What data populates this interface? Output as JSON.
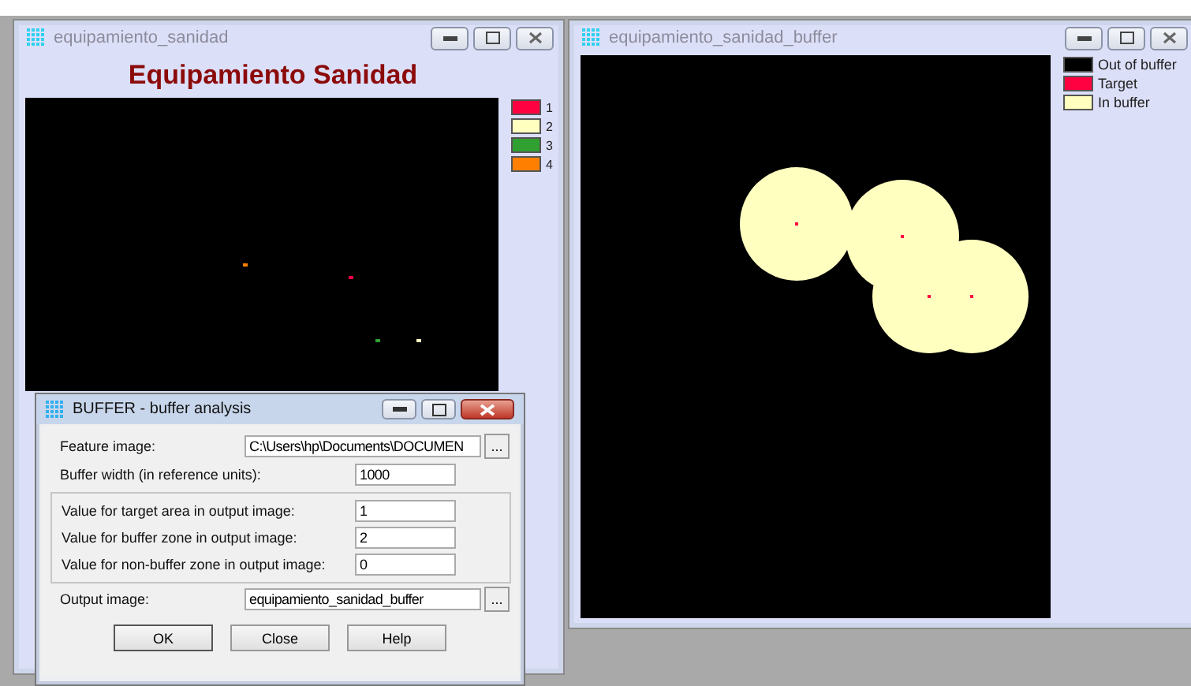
{
  "windows": [
    {
      "title": "equipamiento_sanidad",
      "heading": "Equipamiento Sanidad",
      "legend": [
        {
          "label": "1",
          "color": "#ff0040"
        },
        {
          "label": "2",
          "color": "#ffffc0"
        },
        {
          "label": "3",
          "color": "#30a030"
        },
        {
          "label": "4",
          "color": "#ff8000"
        }
      ]
    },
    {
      "title": "equipamiento_sanidad_buffer",
      "legend": [
        {
          "label": "Out of buffer",
          "color": "#000000"
        },
        {
          "label": "Target",
          "color": "#ff0040"
        },
        {
          "label": "In buffer",
          "color": "#ffffc0"
        }
      ]
    }
  ],
  "dialog": {
    "title": "BUFFER - buffer analysis",
    "sections": [
      {
        "kind": "plain",
        "fields": [
          {
            "label": "Feature image:",
            "value": "C:\\Users\\hp\\Documents\\DOCUMEN",
            "browse": "..."
          },
          {
            "label": "Buffer width (in reference units):",
            "value": "1000"
          }
        ]
      },
      {
        "kind": "boxed",
        "fields": [
          {
            "label": "Value for target area in output image:",
            "value": "1"
          },
          {
            "label": "Value for buffer zone in output image:",
            "value": "2"
          },
          {
            "label": "Value for non-buffer zone in output image:",
            "value": "0"
          }
        ]
      },
      {
        "kind": "plain",
        "fields": [
          {
            "label": "Output image:",
            "value": "equipamiento_sanidad_buffer",
            "browse": "..."
          }
        ]
      }
    ],
    "buttons": [
      "OK",
      "Close",
      "Help"
    ]
  }
}
